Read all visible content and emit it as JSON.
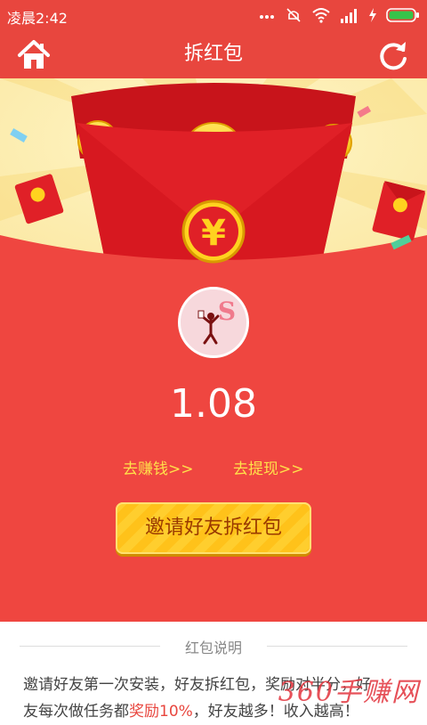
{
  "status_bar": {
    "time": "凌晨2:42",
    "icons": [
      "more-dots-icon",
      "mute-icon",
      "wifi-icon",
      "signal-icon",
      "charging-icon",
      "battery-icon"
    ]
  },
  "header": {
    "title": "拆红包",
    "left_icon": "home-icon",
    "right_icon": "refresh-icon"
  },
  "banner": {
    "coin_symbol": "¥",
    "seal_symbol": "¥"
  },
  "main": {
    "amount": "1.08",
    "earn_link": "去赚钱>>",
    "withdraw_link": "去提现>>",
    "invite_button": "邀请好友拆红包"
  },
  "info": {
    "title": "红包说明",
    "line1": "邀请好友第一次安装，好友拆红包，奖励对半分，好",
    "line2_a": "友每次做任务都",
    "line2_highlight": "奖励10%",
    "line2_b": "，好友越多！收入越高！"
  },
  "watermark": "360手赚网",
  "colors": {
    "primary_red": "#e8463e",
    "gold": "#ffc21a",
    "link_yellow": "#ffe04a"
  }
}
